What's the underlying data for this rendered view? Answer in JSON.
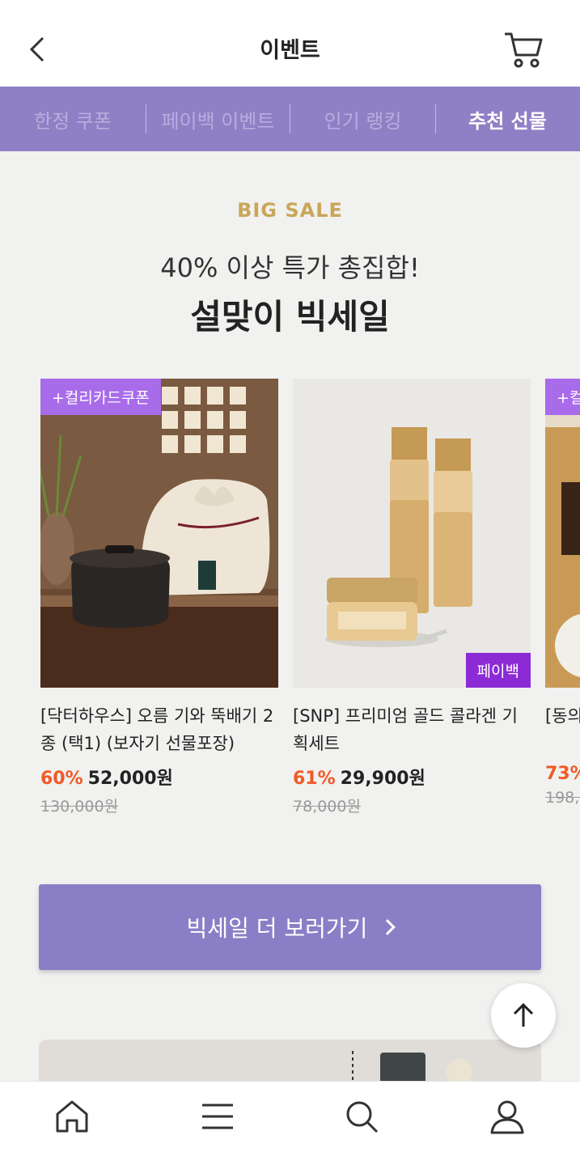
{
  "header": {
    "title": "이벤트",
    "back_icon": "chevron-left-icon",
    "cart_icon": "cart-icon"
  },
  "tabs": [
    {
      "label": "한정 쿠폰",
      "active": false
    },
    {
      "label": "페이백 이벤트",
      "active": false
    },
    {
      "label": "인기 랭킹",
      "active": false
    },
    {
      "label": "추천 선물",
      "active": true
    }
  ],
  "promo": {
    "label": "BIG SALE",
    "subtitle": "40% 이상 특가 총집합!",
    "title": "설맞이 빅세일"
  },
  "products": [
    {
      "coupon_tag": "+컬리카드쿠폰",
      "name": "[닥터하우스] 오름 기와 뚝배기 2종 (택1) (보자기 선물포장)",
      "discount": "60%",
      "price": "52,000원",
      "original_price": "130,000원"
    },
    {
      "payback_tag": "페이백",
      "name": "[SNP] 프리미엄 골드 콜라겐 기획세트",
      "discount": "61%",
      "price": "29,900원",
      "original_price": "78,000원"
    },
    {
      "coupon_tag": "+컬",
      "name": "[동의 자기",
      "discount": "73%",
      "price": "",
      "original_price": "198,0"
    }
  ],
  "more_button": {
    "label": "빅세일 더 보러가기"
  },
  "scroll_top": {
    "icon": "arrow-up-icon"
  },
  "bottom_nav": [
    {
      "icon": "home-icon"
    },
    {
      "icon": "menu-icon"
    },
    {
      "icon": "search-icon"
    },
    {
      "icon": "user-icon"
    }
  ],
  "colors": {
    "accent": "#8f7fc5",
    "sale_gold": "#c9a65a",
    "discount": "#f05a28",
    "coupon_tag": "#a86bea",
    "payback_tag": "#8c2bd6"
  }
}
